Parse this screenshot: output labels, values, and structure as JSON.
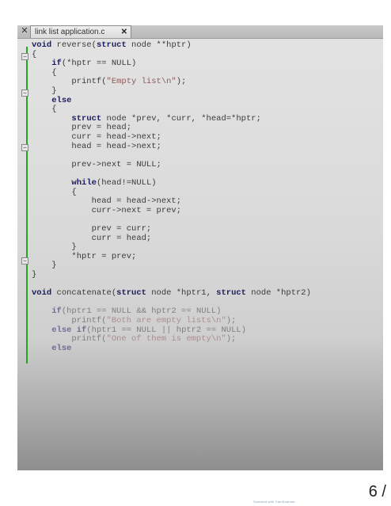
{
  "tab": {
    "title": "link list application.c",
    "close_glyph": "✕",
    "panel_close_glyph": "✕"
  },
  "code_lines": [
    "void reverse(struct node **hptr)",
    "{",
    "    if(*hptr == NULL)",
    "    {",
    "        printf(\"Empty list\\n\");",
    "    }",
    "    else",
    "    {",
    "        struct node *prev, *curr, *head=*hptr;",
    "        prev = head;",
    "        curr = head->next;",
    "        head = head->next;",
    "",
    "        prev->next = NULL;",
    "",
    "        while(head!=NULL)",
    "        {",
    "            head = head->next;",
    "            curr->next = prev;",
    "",
    "            prev = curr;",
    "            curr = head;",
    "        }",
    "        *hptr = prev;",
    "    }",
    "}",
    "",
    "void concatenate(struct node *hptr1, struct node *hptr2)",
    "",
    "    if(hptr1 == NULL && hptr2 == NULL)",
    "        printf(\"Both are empty lists\\n\");",
    "    else if(hptr1 == NULL || hptr2 == NULL)",
    "        printf(\"One of them is empty\\n\");",
    "    else"
  ],
  "footer": {
    "page_number": "6 /",
    "watermark": "Scanned with CamScanner"
  }
}
